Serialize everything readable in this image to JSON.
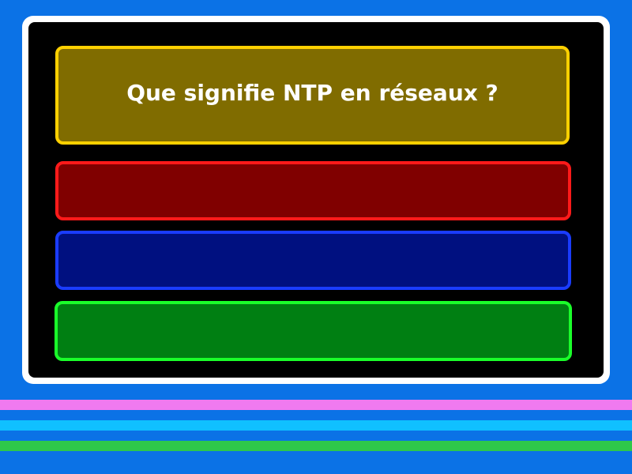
{
  "question": {
    "text": "Que signifie NTP en réseaux ?"
  },
  "answers": [
    {
      "label": ""
    },
    {
      "label": ""
    },
    {
      "label": ""
    }
  ],
  "colors": {
    "background": "#0b72e6",
    "frame": "#ffffff",
    "screen": "#000000",
    "question_fill": "#806c00",
    "question_border": "#ffd000",
    "answer_1_fill": "#800000",
    "answer_1_border": "#ff1a1a",
    "answer_2_fill": "#001080",
    "answer_2_border": "#1a3cff",
    "answer_3_fill": "#007f12",
    "answer_3_border": "#1aff2a",
    "stripe_1": "#f07af0",
    "stripe_2": "#10c0ff",
    "stripe_3": "#2ec84a"
  }
}
